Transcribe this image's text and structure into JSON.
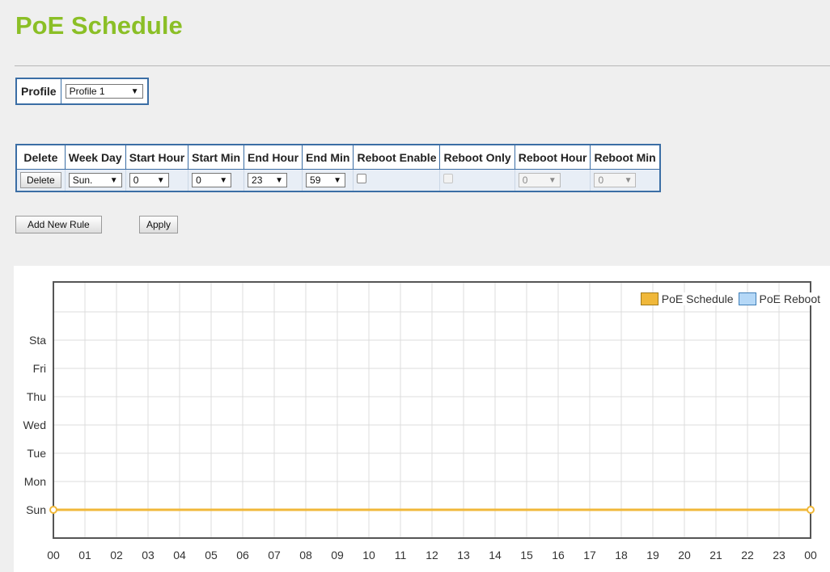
{
  "page": {
    "title": "PoE Schedule"
  },
  "profile": {
    "label": "Profile",
    "selected": "Profile 1"
  },
  "rules_table": {
    "headers": [
      "Delete",
      "Week Day",
      "Start Hour",
      "Start Min",
      "End Hour",
      "End Min",
      "Reboot Enable",
      "Reboot Only",
      "Reboot Hour",
      "Reboot Min"
    ],
    "row": {
      "delete_label": "Delete",
      "week_day": "Sun.",
      "start_hour": "0",
      "start_min": "0",
      "end_hour": "23",
      "end_min": "59",
      "reboot_enable": false,
      "reboot_only": false,
      "reboot_hour": "0",
      "reboot_min": "0"
    }
  },
  "buttons": {
    "add_rule": "Add New Rule",
    "apply": "Apply"
  },
  "colors": {
    "title": "#8bbf26",
    "border": "#3b6ea5",
    "schedule": "#f0b83a",
    "reboot": "#b5d8f7"
  },
  "chart_data": {
    "type": "line",
    "y_categories": [
      "Sun",
      "Mon",
      "Tue",
      "Wed",
      "Thu",
      "Fri",
      "Sta"
    ],
    "x_ticks": [
      "00",
      "01",
      "02",
      "03",
      "04",
      "05",
      "06",
      "07",
      "08",
      "09",
      "10",
      "11",
      "12",
      "13",
      "14",
      "15",
      "16",
      "17",
      "18",
      "19",
      "20",
      "21",
      "22",
      "23",
      "00"
    ],
    "xlim": [
      0,
      24
    ],
    "grid": true,
    "legend_position": "top-right",
    "series": [
      {
        "name": "PoE Schedule",
        "color": "#f0b83a",
        "segments": [
          {
            "day": "Sun",
            "start": 0,
            "end": 24
          }
        ]
      },
      {
        "name": "PoE Reboot",
        "color": "#b5d8f7",
        "segments": []
      }
    ]
  }
}
